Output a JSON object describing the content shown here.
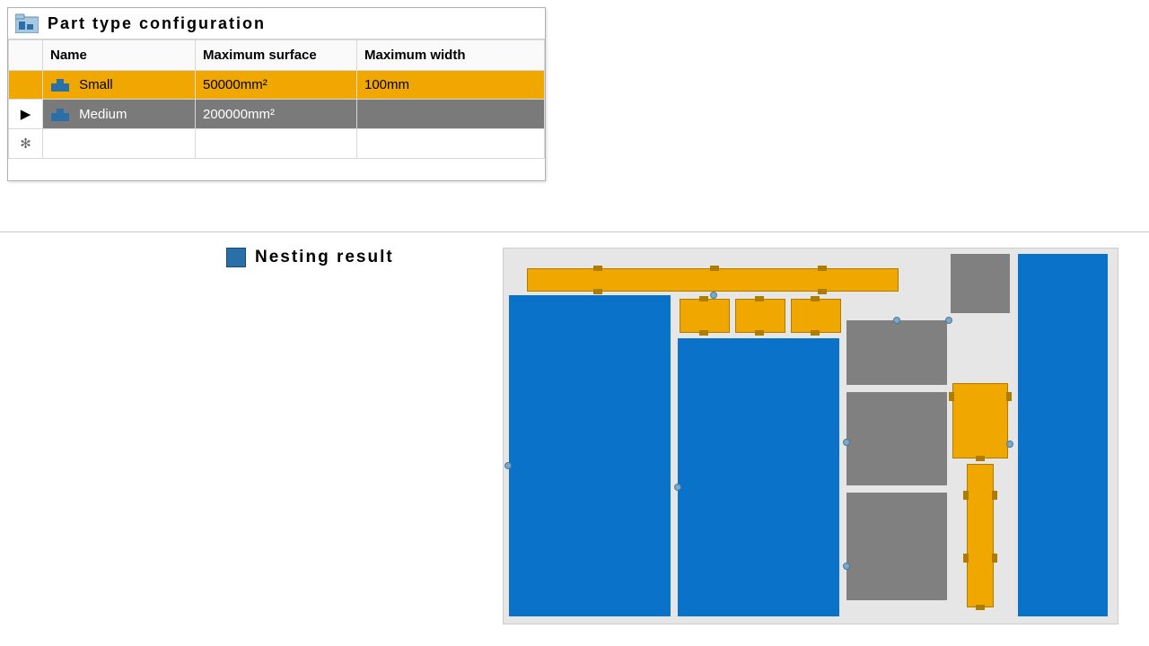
{
  "config_panel": {
    "title": "Part type configuration",
    "columns": [
      "",
      "Name",
      "Maximum surface",
      "Maximum width"
    ],
    "rows": [
      {
        "marker": "",
        "name": "Small",
        "surface": "50000mm²",
        "width": "100mm",
        "state": "selected"
      },
      {
        "marker": "▶",
        "name": "Medium",
        "surface": "200000mm²",
        "width": "",
        "state": "editing"
      },
      {
        "marker": "✻",
        "name": "",
        "surface": "",
        "width": "",
        "state": "empty"
      }
    ]
  },
  "nesting": {
    "title": "Nesting result"
  }
}
